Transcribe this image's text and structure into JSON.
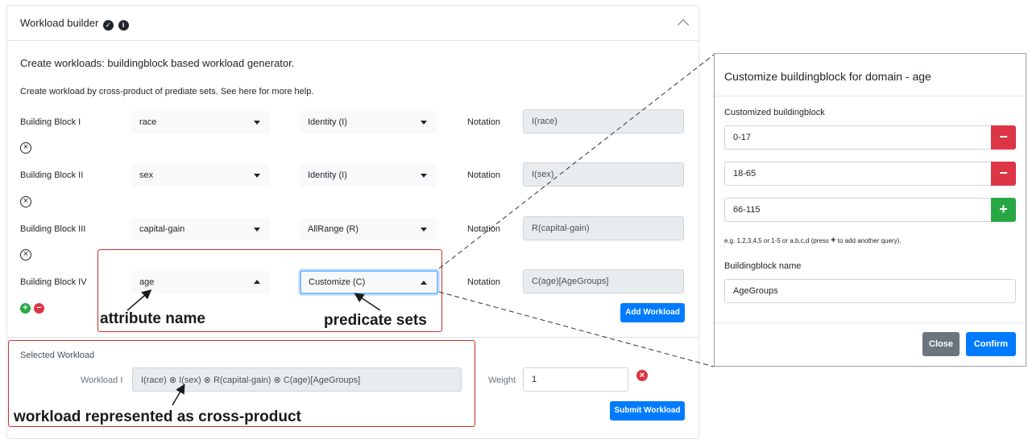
{
  "workload_builder": {
    "title": "Workload builder",
    "title_icons": [
      "check-circle-icon",
      "info-circle-icon"
    ],
    "intro": "Create workloads: buildingblock based workload generator.",
    "help_text": "Create workload by cross-product of prediate sets. See here for more help.",
    "notation_label": "Notation",
    "blocks": [
      {
        "label": "Building Block I",
        "attribute": "race",
        "predicate": "Identity (I)",
        "notation": "I(race)"
      },
      {
        "label": "Building Block II",
        "attribute": "sex",
        "predicate": "Identity (I)",
        "notation": "I(sex)"
      },
      {
        "label": "Building Block III",
        "attribute": "capital-gain",
        "predicate": "AllRange (R)",
        "notation": "R(capital-gain)"
      },
      {
        "label": "Building Block IV",
        "attribute": "age",
        "predicate": "Customize (C)",
        "notation": "C(age)[AgeGroups]"
      }
    ],
    "add_workload_button": "Add Workload"
  },
  "selected_workload": {
    "heading": "Selected Workload",
    "workload_label": "Workload I",
    "workload_value": "I(race) ⊗ I(sex) ⊗ R(capital-gain) ⊗ C(age)[AgeGroups]",
    "weight_label": "Weight",
    "weight_value": "1",
    "submit_button": "Submit Workload"
  },
  "annotations": {
    "attribute_name": "attribute name",
    "predicate_sets": "predicate sets",
    "cross_product": "workload represented as cross-product"
  },
  "modal": {
    "title": "Customize buildingblock for domain - age",
    "customized_label": "Customized buildingblock",
    "entries": [
      "0-17",
      "18-65",
      "66-115"
    ],
    "hint_prefix": "e.g. 1,2,3,4,5 or 1-5 or a,b,c,d (press",
    "hint_suffix": "to add another query).",
    "name_label": "Buildingblock name",
    "name_value": "AgeGroups",
    "close_button": "Close",
    "confirm_button": "Confirm"
  },
  "colors": {
    "primary": "#007bff",
    "danger": "#dc3545",
    "success": "#28a745",
    "annotation": "#c9302c"
  }
}
